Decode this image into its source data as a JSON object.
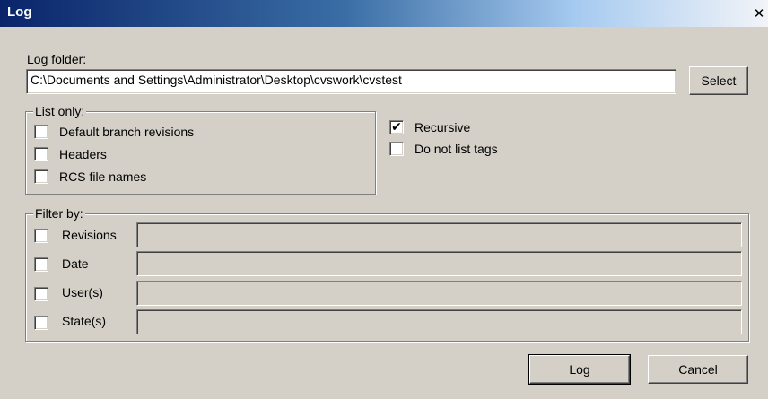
{
  "window": {
    "title": "Log",
    "close_glyph": "✕"
  },
  "log_folder": {
    "label": "Log folder:",
    "value": "C:\\Documents and Settings\\Administrator\\Desktop\\cvswork\\cvstest",
    "select_button": "Select"
  },
  "list_only": {
    "legend": "List only:",
    "items": [
      {
        "label": "Default branch revisions",
        "checked": false
      },
      {
        "label": "Headers",
        "checked": false
      },
      {
        "label": "RCS file names",
        "checked": false
      }
    ]
  },
  "options": {
    "recursive": {
      "label": "Recursive",
      "checked": true
    },
    "no_tags": {
      "label": "Do not list tags",
      "checked": false
    }
  },
  "filter_by": {
    "legend": "Filter by:",
    "items": [
      {
        "label": "Revisions",
        "checked": false,
        "value": ""
      },
      {
        "label": "Date",
        "checked": false,
        "value": ""
      },
      {
        "label": "User(s)",
        "checked": false,
        "value": ""
      },
      {
        "label": "State(s)",
        "checked": false,
        "value": ""
      }
    ]
  },
  "buttons": {
    "ok": "Log",
    "cancel": "Cancel"
  },
  "check_glyph": "✔"
}
